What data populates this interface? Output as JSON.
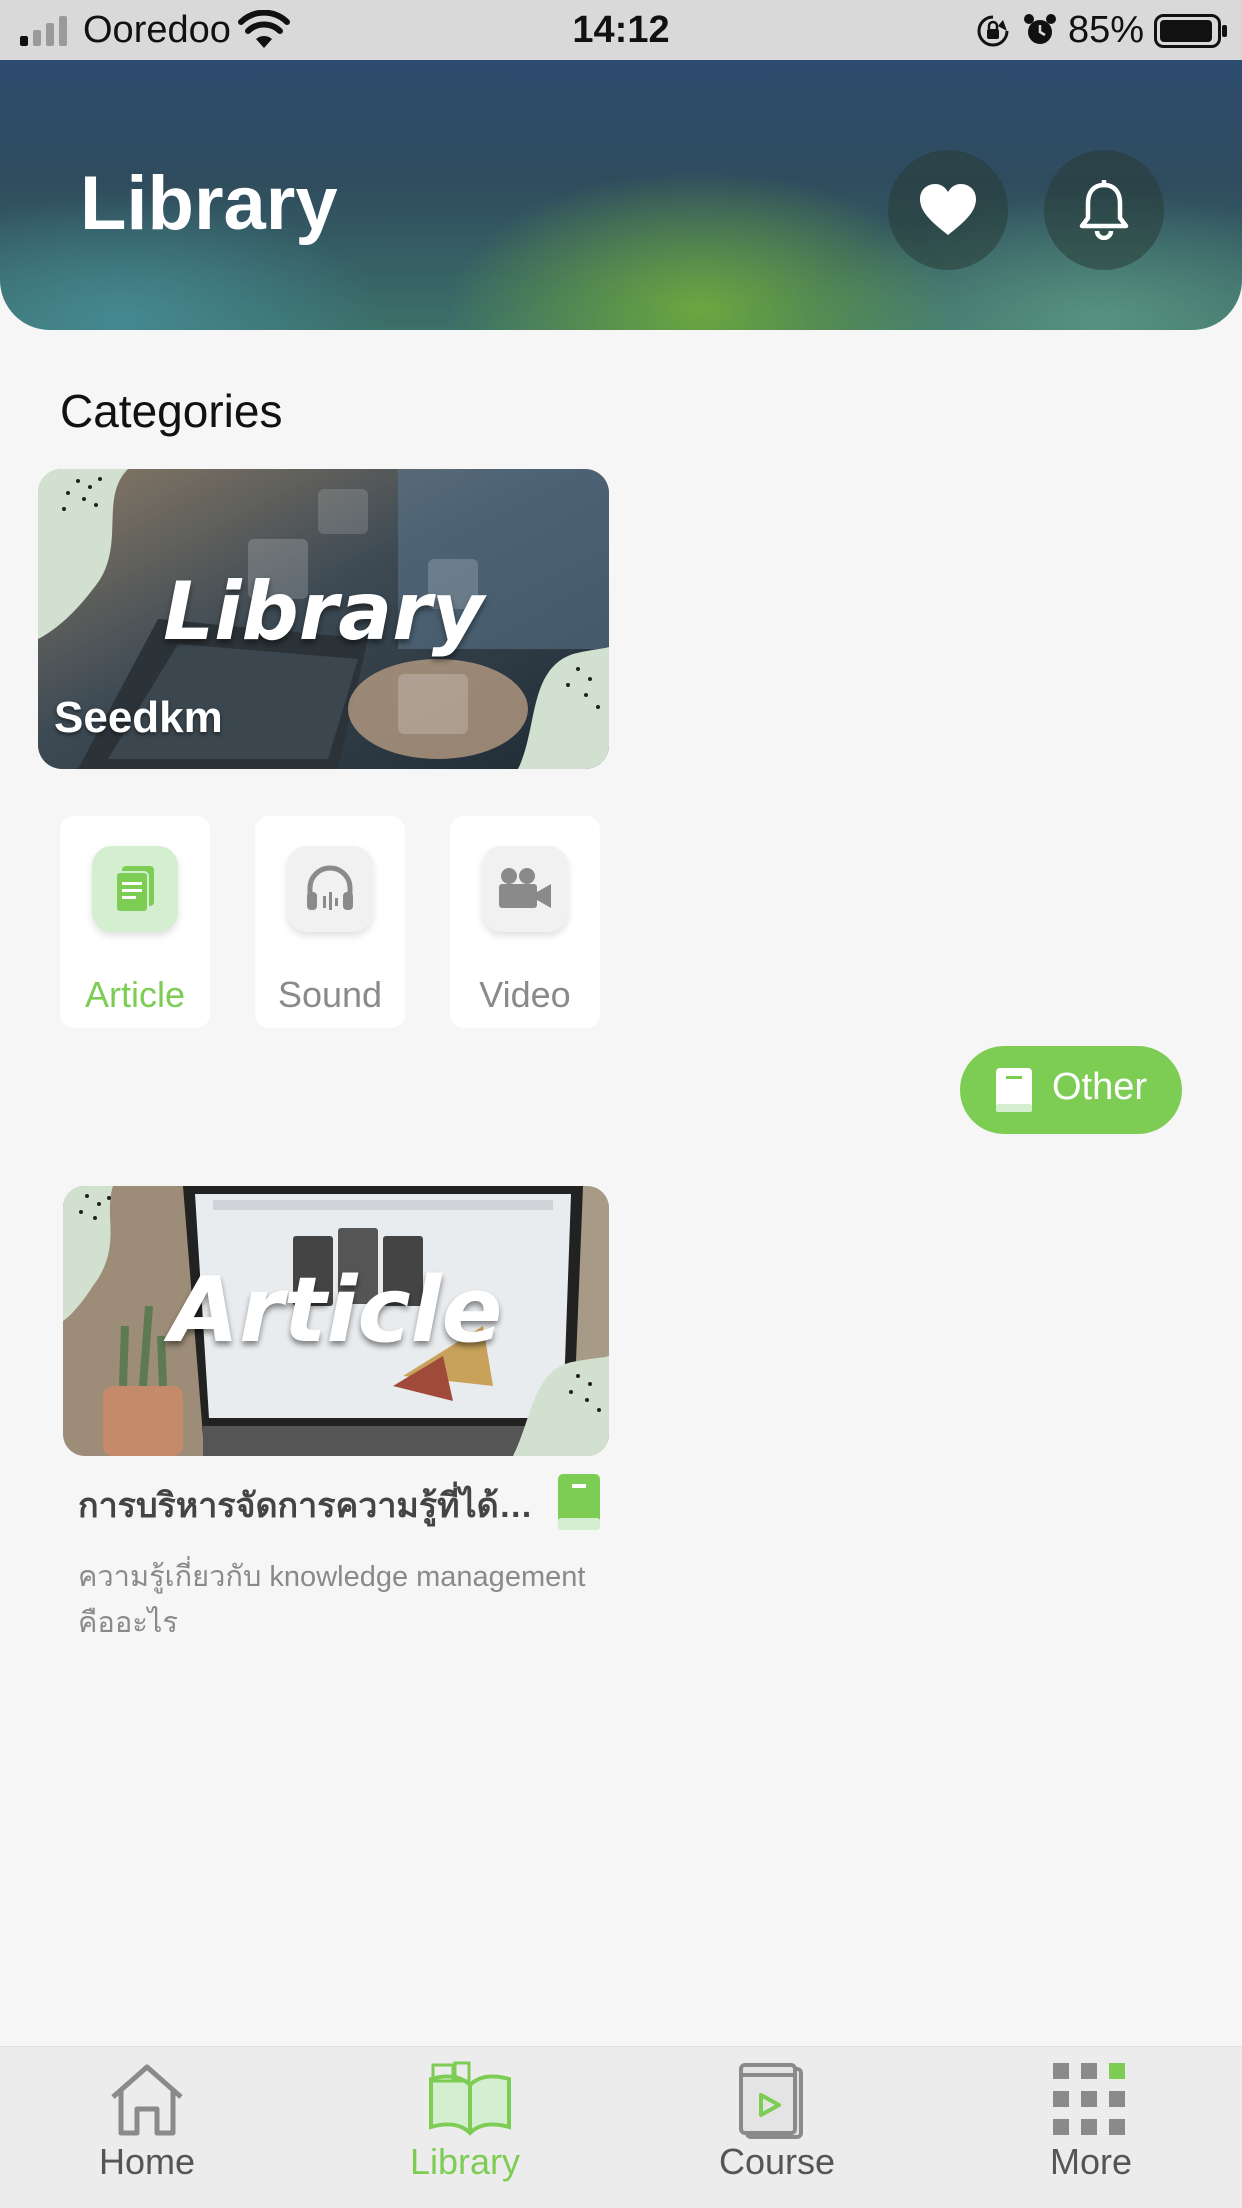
{
  "status_bar": {
    "carrier": "Ooredoo",
    "time": "14:12",
    "battery_percent": "85%"
  },
  "header": {
    "title": "Library",
    "favorites_icon": "heart-icon",
    "notifications_icon": "bell-icon"
  },
  "categories": {
    "title": "Categories",
    "banner": {
      "title": "Library",
      "subtitle": "Seedkm"
    },
    "tiles": [
      {
        "label": "Article",
        "icon": "document-icon",
        "active": true
      },
      {
        "label": "Sound",
        "icon": "headphones-icon",
        "active": false
      },
      {
        "label": "Video",
        "icon": "video-camera-icon",
        "active": false
      }
    ],
    "other_button": {
      "label": "Other",
      "icon": "book-icon"
    }
  },
  "content": {
    "cards": [
      {
        "image_text": "Article",
        "title": "การบริหารจัดการความรู้ที่ได้ร…",
        "description": "ความรู้เกี่ยวกับ knowledge management คืออะไร",
        "type_icon": "book-icon"
      }
    ]
  },
  "tab_bar": {
    "items": [
      {
        "label": "Home",
        "icon": "home-icon",
        "active": false
      },
      {
        "label": "Library",
        "icon": "library-icon",
        "active": true
      },
      {
        "label": "Course",
        "icon": "course-icon",
        "active": false
      },
      {
        "label": "More",
        "icon": "grid-icon",
        "active": false
      }
    ]
  },
  "colors": {
    "accent": "#7dcd55",
    "inactive": "#8a8a8a",
    "background": "#f6f6f6"
  }
}
